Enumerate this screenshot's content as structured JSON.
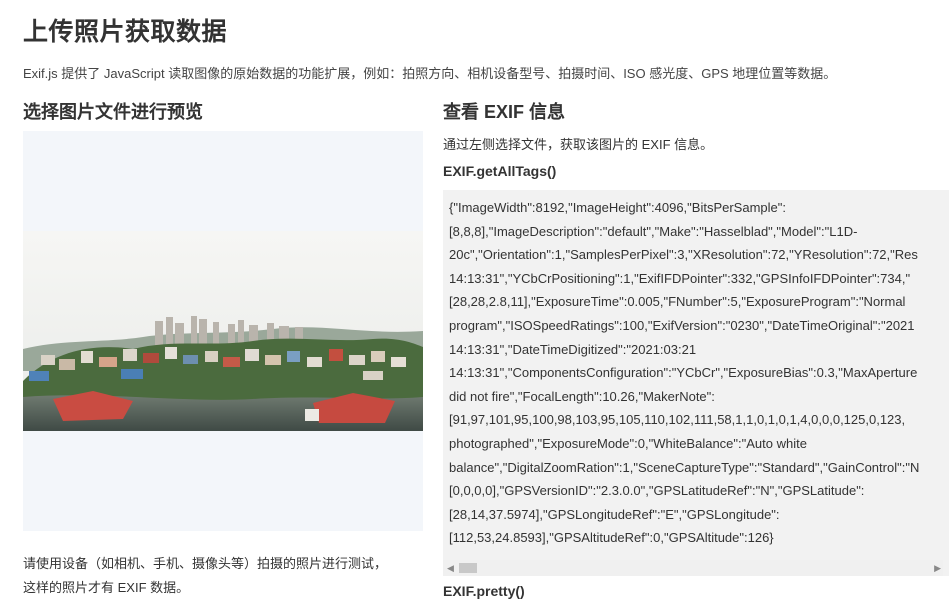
{
  "page": {
    "title": "上传照片获取数据",
    "intro": "Exif.js 提供了 JavaScript 读取图像的原始数据的功能扩展，例如：拍照方向、相机设备型号、拍摄时间、ISO 感光度、GPS 地理位置等数据。"
  },
  "left": {
    "title": "选择图片文件进行预览",
    "hint_line1": "请使用设备（如相机、手机、摄像头等）拍摄的照片进行测试，",
    "hint_line2": "这样的照片才有 EXIF 数据。"
  },
  "right": {
    "title": "查看 EXIF 信息",
    "desc": "通过左侧选择文件，获取该图片的 EXIF 信息。",
    "api_alltags": "EXIF.getAllTags()",
    "api_pretty": "EXIF.pretty()",
    "code_lines": [
      "{\"ImageWidth\":8192,\"ImageHeight\":4096,\"BitsPerSample\":",
      "[8,8,8],\"ImageDescription\":\"default\",\"Make\":\"Hasselblad\",\"Model\":\"L1D-",
      "20c\",\"Orientation\":1,\"SamplesPerPixel\":3,\"XResolution\":72,\"YResolution\":72,\"Res",
      "14:13:31\",\"YCbCrPositioning\":1,\"ExifIFDPointer\":332,\"GPSInfoIFDPointer\":734,\"",
      "[28,28,2.8,11],\"ExposureTime\":0.005,\"FNumber\":5,\"ExposureProgram\":\"Normal",
      "program\",\"ISOSpeedRatings\":100,\"ExifVersion\":\"0230\",\"DateTimeOriginal\":\"2021",
      "14:13:31\",\"DateTimeDigitized\":\"2021:03:21",
      "14:13:31\",\"ComponentsConfiguration\":\"YCbCr\",\"ExposureBias\":0.3,\"MaxAperture",
      "did not fire\",\"FocalLength\":10.26,\"MakerNote\":",
      "[91,97,101,95,100,98,103,95,105,110,102,111,58,1,1,0,1,0,1,4,0,0,0,125,0,123,",
      "photographed\",\"ExposureMode\":0,\"WhiteBalance\":\"Auto white",
      "balance\",\"DigitalZoomRation\":1,\"SceneCaptureType\":\"Standard\",\"GainControl\":\"N",
      "[0,0,0,0],\"GPSVersionID\":\"2.3.0.0\",\"GPSLatitudeRef\":\"N\",\"GPSLatitude\":",
      "[28,14,37.5974],\"GPSLongitudeRef\":\"E\",\"GPSLongitude\":",
      "[112,53,24.8593],\"GPSAltitudeRef\":0,\"GPSAltitude\":126}"
    ]
  },
  "scrollbar": {
    "left_arrow": "◀",
    "right_arrow": "▶"
  }
}
